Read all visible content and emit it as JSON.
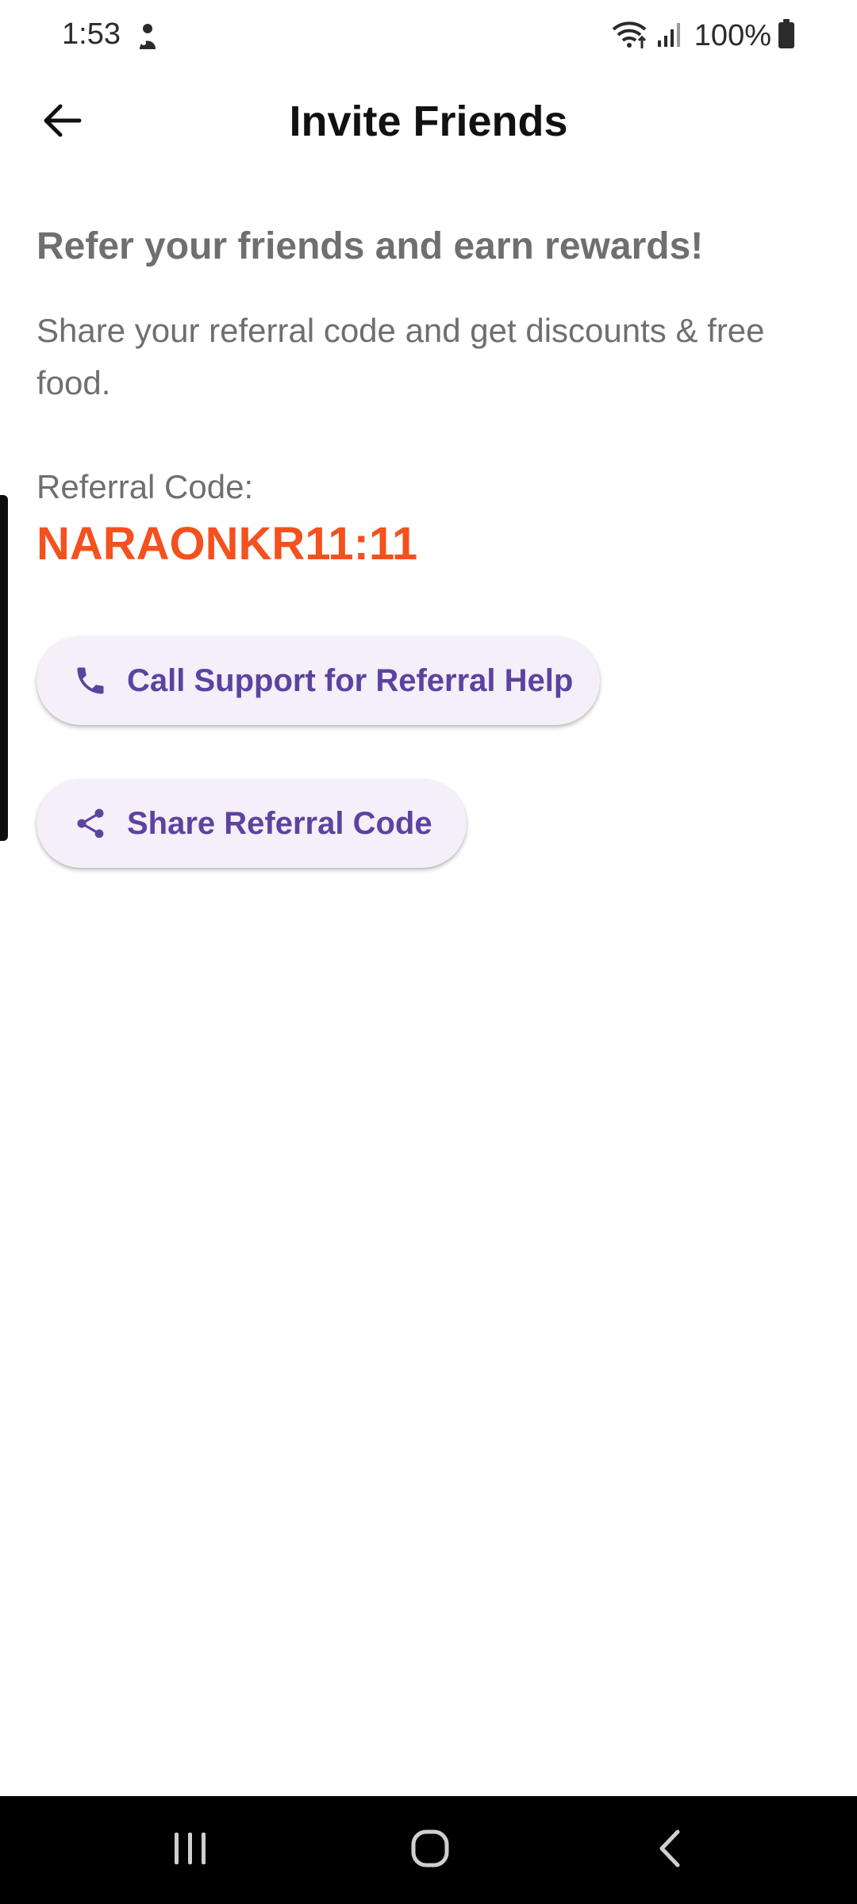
{
  "status_bar": {
    "time": "1:53",
    "battery": "100%",
    "icons": [
      "notification-icon",
      "wifi-icon",
      "signal-icon",
      "battery-icon"
    ]
  },
  "app_bar": {
    "title": "Invite Friends",
    "back_icon": "arrow-back-icon"
  },
  "content": {
    "headline": "Refer your friends and earn rewards!",
    "description": "Share your referral code and get discounts & free food.",
    "referral_label": "Referral Code:",
    "referral_code": "NARAONKR11:11"
  },
  "actions": {
    "call_support": {
      "label": "Call Support for Referral Help",
      "icon": "phone-icon"
    },
    "share_code": {
      "label": "Share Referral Code",
      "icon": "share-icon"
    }
  },
  "nav_bar": {
    "icons": [
      "recent-apps-icon",
      "home-icon",
      "back-icon"
    ]
  },
  "colors": {
    "accent": "#5b43a0",
    "code": "#f4511e",
    "button_bg": "#f4eff8",
    "text_secondary": "#6f6f6f"
  }
}
